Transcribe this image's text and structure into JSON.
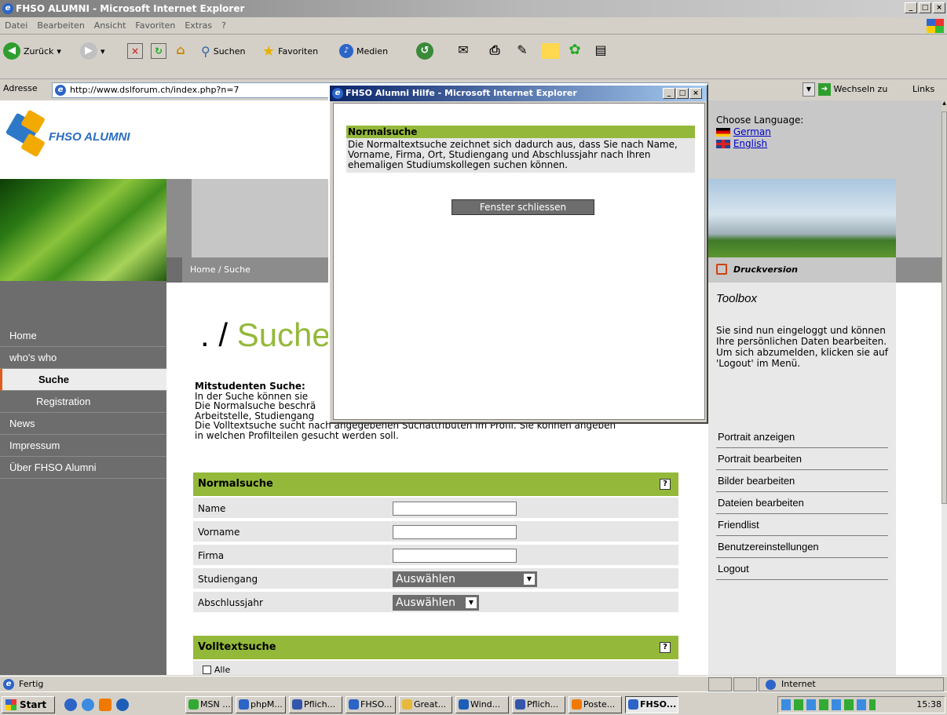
{
  "window": {
    "title": "FHSO ALUMNI - Microsoft Internet Explorer"
  },
  "menu": [
    "Datei",
    "Bearbeiten",
    "Ansicht",
    "Favoriten",
    "Extras",
    "?"
  ],
  "toolbar": {
    "back": "Zurück",
    "search": "Suchen",
    "favorites": "Favoriten",
    "media": "Medien"
  },
  "address": {
    "label": "Adresse",
    "url": "http://www.dslforum.ch/index.php?n=7",
    "go": "Wechseln zu",
    "links": "Links"
  },
  "site": {
    "logo": "FHSO ALUMNI",
    "language": {
      "label": "Choose Language:",
      "german": "German",
      "english": "English"
    },
    "breadcrumb": "Home / Suche",
    "nav": [
      "Home",
      "who's who",
      "Suche",
      "Registration",
      "News",
      "Impressum",
      "Über FHSO Alumni"
    ],
    "page_title_prefix": ". /",
    "page_title": "Suche",
    "intro_heading": "Mitstudenten Suche:",
    "intro_lines": [
      "In der Suche können sie",
      "Die Normalsuche beschrä",
      "Arbeitstelle, Studiengang",
      "Die Volltextsuche sucht nach angegebenen Suchattributen im Profil. Sie können angeben",
      "in welchen Profilteilen gesucht werden soll."
    ],
    "normal_search": {
      "title": "Normalsuche",
      "help": "?",
      "fields": [
        "Name",
        "Vorname",
        "Firma",
        "Studiengang",
        "Abschlussjahr"
      ],
      "select_placeholder": "Auswählen"
    },
    "fulltext_search": {
      "title": "Volltextsuche",
      "help": "?",
      "first_option": "Alle"
    },
    "print": "Druckversion",
    "toolbox": {
      "title": "Toolbox",
      "text": "Sie sind nun eingeloggt und können Ihre persönlichen Daten bearbeiten. Um sich abzumelden, klicken sie auf 'Logout' im Menü.",
      "links": [
        "Portrait anzeigen",
        "Portrait bearbeiten",
        "Bilder bearbeiten",
        "Dateien bearbeiten",
        "Friendlist",
        "Benutzereinstellungen",
        "Logout"
      ]
    }
  },
  "popup": {
    "title": "FHSO Alumni Hilfe - Microsoft Internet Explorer",
    "heading": "Normalsuche",
    "text": "Die Normaltextsuche zeichnet sich dadurch aus, dass Sie nach Name, Vorname, Firma, Ort, Studiengang und Abschlussjahr nach Ihren ehemaligen Studiumskollegen suchen können.",
    "close_button": "Fenster schliessen"
  },
  "status": {
    "text": "Fertig",
    "zone": "Internet"
  },
  "taskbar": {
    "start": "Start",
    "buttons": [
      "MSN ...",
      "phpM...",
      "Pflich...",
      "FHSO...",
      "Great...",
      "Wind...",
      "Pflich...",
      "Poste...",
      "FHSO..."
    ],
    "clock": "15:38"
  },
  "colors": {
    "accent_green": "#94b93a",
    "nav_gray": "#6d6d6d",
    "active_marker": "#e05a1a"
  }
}
